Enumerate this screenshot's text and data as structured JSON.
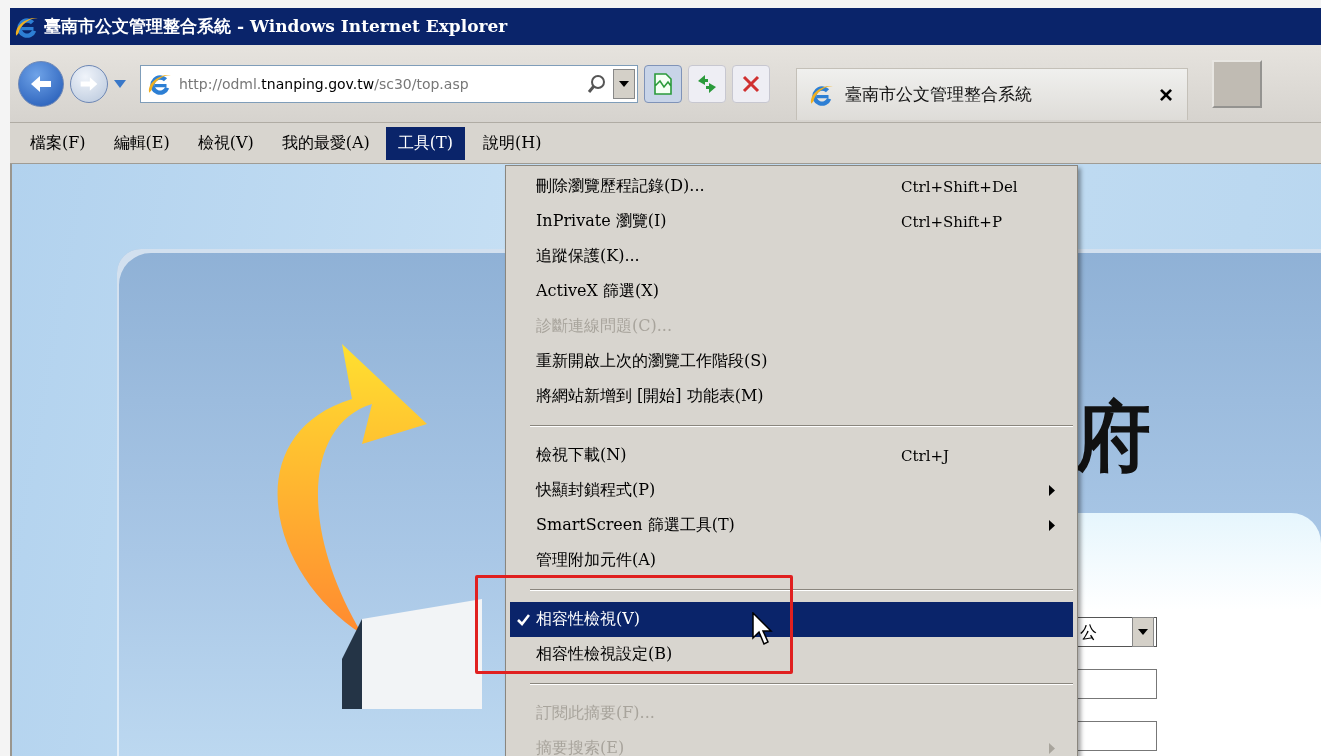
{
  "window": {
    "title": "臺南市公文管理整合系統 - Windows Internet Explorer"
  },
  "address_bar": {
    "value": "http://odml.**tnanping.gov.tw**/sc30/top.asp"
  },
  "tab": {
    "title": "臺南市公文管理整合系統",
    "close": "×"
  },
  "menu_bar": [
    {
      "label": "檔案(F)",
      "selected": false
    },
    {
      "label": "編輯(E)",
      "selected": false
    },
    {
      "label": "檢視(V)",
      "selected": false
    },
    {
      "label": "我的最愛(A)",
      "selected": false
    },
    {
      "label": "工具(T)",
      "selected": true
    },
    {
      "label": "說明(H)",
      "selected": false
    }
  ],
  "tools_menu": {
    "items": [
      {
        "kind": "item",
        "label": "刪除瀏覽歷程記錄(D)...",
        "shortcut": "Ctrl+Shift+Del",
        "disabled": false,
        "checked": false,
        "selected": false,
        "submenu": false
      },
      {
        "kind": "item",
        "label": "InPrivate 瀏覽(I)",
        "shortcut": "Ctrl+Shift+P",
        "disabled": false,
        "checked": false,
        "selected": false,
        "submenu": false
      },
      {
        "kind": "item",
        "label": "追蹤保護(K)...",
        "disabled": false,
        "checked": false,
        "selected": false,
        "submenu": false
      },
      {
        "kind": "item",
        "label": "ActiveX 篩選(X)",
        "disabled": false,
        "checked": false,
        "selected": false,
        "submenu": false
      },
      {
        "kind": "item",
        "label": "診斷連線問題(C)...",
        "disabled": true,
        "checked": false,
        "selected": false,
        "submenu": false
      },
      {
        "kind": "item",
        "label": "重新開啟上次的瀏覽工作階段(S)",
        "disabled": false,
        "checked": false,
        "selected": false,
        "submenu": false
      },
      {
        "kind": "item",
        "label": "將網站新增到 [開始] 功能表(M)",
        "disabled": false,
        "checked": false,
        "selected": false,
        "submenu": false
      },
      {
        "kind": "separator"
      },
      {
        "kind": "item",
        "label": "檢視下載(N)",
        "shortcut": "Ctrl+J",
        "disabled": false,
        "checked": false,
        "selected": false,
        "submenu": false
      },
      {
        "kind": "item",
        "label": "快顯封鎖程式(P)",
        "disabled": false,
        "checked": false,
        "selected": false,
        "submenu": true
      },
      {
        "kind": "item",
        "label": "SmartScreen 篩選工具(T)",
        "disabled": false,
        "checked": false,
        "selected": false,
        "submenu": true
      },
      {
        "kind": "item",
        "label": "管理附加元件(A)",
        "disabled": false,
        "checked": false,
        "selected": false,
        "submenu": false
      },
      {
        "kind": "separator"
      },
      {
        "kind": "item",
        "label": "相容性檢視(V)",
        "disabled": false,
        "checked": true,
        "selected": true,
        "submenu": false
      },
      {
        "kind": "item",
        "label": "相容性檢視設定(B)",
        "disabled": false,
        "checked": false,
        "selected": false,
        "submenu": false
      },
      {
        "kind": "separator"
      },
      {
        "kind": "item",
        "label": "訂閱此摘要(F)...",
        "disabled": true,
        "checked": false,
        "selected": false,
        "submenu": false
      },
      {
        "kind": "item",
        "label": "摘要搜索(E)",
        "disabled": true,
        "checked": false,
        "selected": false,
        "submenu": true
      }
    ]
  },
  "page": {
    "heading": "府",
    "select": {
      "value": "公"
    }
  }
}
